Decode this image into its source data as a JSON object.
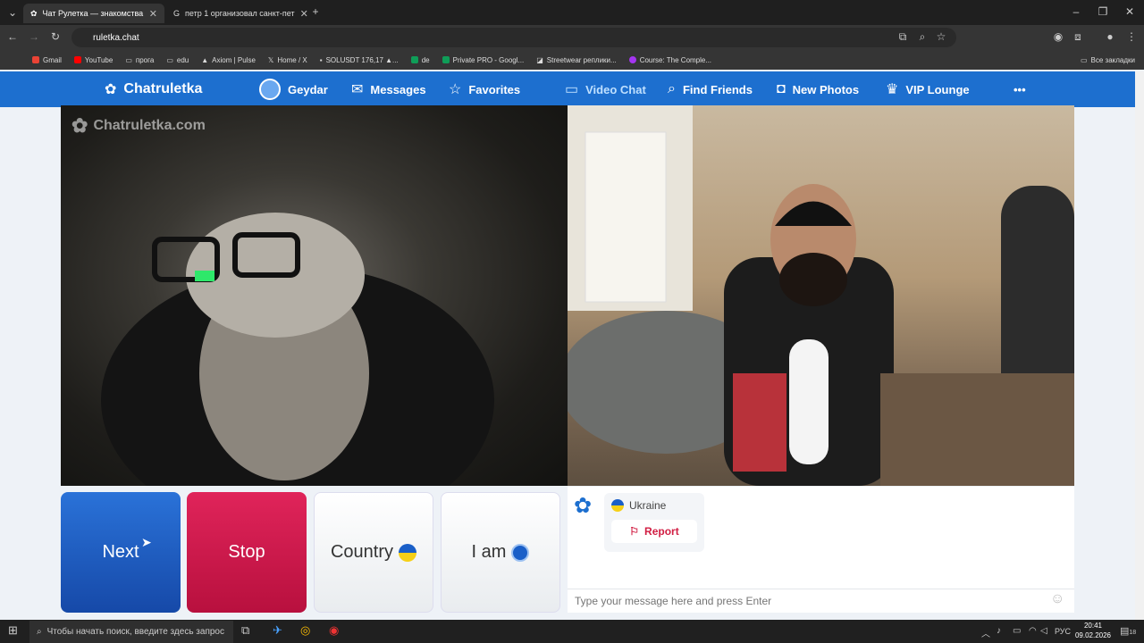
{
  "browser": {
    "tabs": [
      {
        "title": "Чат Рулетка — знакомства"
      },
      {
        "title": "петр 1 организовал санкт-пет"
      }
    ],
    "address": "ruletka.chat",
    "bookmarks": [
      "Gmail",
      "YouTube",
      "прога",
      "edu",
      "Axiom | Pulse",
      "Home / X",
      "SOLUSDT 176,17 ▲...",
      "de",
      "Private PRO - Googl...",
      "Streetwear реплики...",
      "Course: The Comple..."
    ],
    "all_bookmarks": "Все закладки"
  },
  "site": {
    "logo": "Chatruletka",
    "nav": {
      "user": "Geydar",
      "messages": "Messages",
      "favorites": "Favorites",
      "video_chat": "Video Chat",
      "find_friends": "Find Friends",
      "new_photos": "New Photos",
      "vip_lounge": "VIP Lounge",
      "more": "•••"
    },
    "watermark": "Chatruletka.com",
    "buttons": {
      "next": "Next",
      "stop": "Stop",
      "country": "Country",
      "iam": "I am"
    },
    "chat": {
      "partner_country": "Ukraine",
      "report": "Report",
      "placeholder": "Type your message here and press Enter"
    }
  },
  "taskbar": {
    "search_placeholder": "Чтобы начать поиск, введите здесь запрос",
    "lang": "РУС",
    "time": "20:41",
    "date": "09.02.2026",
    "notifications": "18"
  },
  "colors": {
    "nav_blue": "#1d6fcf",
    "next_blue": "#1f5fc4",
    "stop_red": "#d0184d"
  }
}
